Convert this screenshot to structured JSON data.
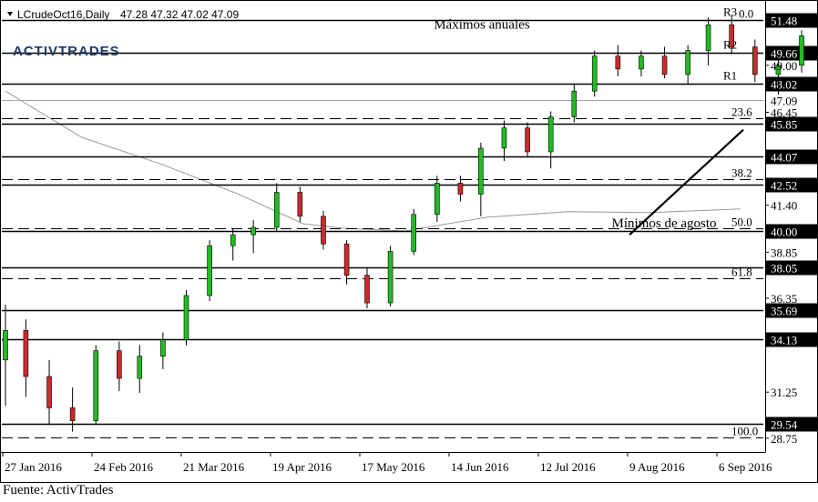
{
  "header": {
    "symbol": "LCrudeOct16,Daily",
    "ohlc": "47.28 47.32 47.02 47.09"
  },
  "logo": {
    "text": "ACTIVTRADES"
  },
  "source": "Fuente: ActivTrades",
  "colors": {
    "bull": "#22bb22",
    "bear": "#cc2a2a",
    "ma": "#999999",
    "line": "#000000"
  },
  "chart_data": {
    "type": "candlestick",
    "ylim": [
      28.1,
      52.3
    ],
    "x_axis_labels": [
      "27 Jan 2016",
      "24 Feb 2016",
      "21 Mar 2016",
      "19 Apr 2016",
      "17 May 2016",
      "14 Jun 2016",
      "12 Jul 2016",
      "9 Aug 2016",
      "6 Sep 2016"
    ],
    "price_scale_labels": [
      "49.00",
      "46.45",
      "41.40",
      "38.85",
      "36.35",
      "31.25",
      "28.75"
    ],
    "levels": [
      {
        "value": 51.48,
        "style": "solid",
        "tag": "R3",
        "tag_value": ""
      },
      {
        "value": 49.66,
        "style": "solid",
        "tag": "R2",
        "tag_value": ""
      },
      {
        "value": 48.02,
        "style": "solid",
        "tag": "R1",
        "tag_value": ""
      },
      {
        "value": 47.09,
        "style": "current",
        "tag": "",
        "tag_value": ""
      },
      {
        "value": 45.85,
        "style": "solid",
        "tag": "",
        "tag_value": ""
      },
      {
        "value": 44.07,
        "style": "solid",
        "tag": "",
        "tag_value": ""
      },
      {
        "value": 42.52,
        "style": "solid",
        "tag": "",
        "tag_value": ""
      },
      {
        "value": 40.0,
        "style": "solid",
        "tag": "",
        "tag_value": ""
      },
      {
        "value": 38.05,
        "style": "solid",
        "tag": "",
        "tag_value": ""
      },
      {
        "value": 35.69,
        "style": "solid",
        "tag": "",
        "tag_value": ""
      },
      {
        "value": 34.13,
        "style": "solid",
        "tag": "",
        "tag_value": ""
      },
      {
        "value": 29.54,
        "style": "solid",
        "tag": "",
        "tag_value": ""
      }
    ],
    "fibonacci": [
      {
        "label": "0.0",
        "value": 51.48
      },
      {
        "label": "23.6",
        "value": 46.12
      },
      {
        "label": "38.2",
        "value": 42.8
      },
      {
        "label": "50.0",
        "value": 40.13
      },
      {
        "label": "61.8",
        "value": 37.45
      },
      {
        "label": "100.0",
        "value": 28.78
      }
    ],
    "annotations": [
      {
        "text": "Máximos anuales",
        "date": "2016-05-30",
        "value": 51.0
      },
      {
        "text": "Mínimos de agosto",
        "date": "2016-07-30",
        "value": 40.2
      }
    ],
    "trendline": {
      "start": {
        "date": "2016-08-02",
        "value": 39.8
      },
      "end": {
        "date": "2016-09-10",
        "value": 45.5
      }
    },
    "moving_average": {
      "dates": [
        "2016-01-01",
        "2016-01-27",
        "2016-02-24",
        "2016-03-21",
        "2016-04-12",
        "2016-04-26",
        "2016-05-17",
        "2016-06-14",
        "2016-07-12",
        "2016-08-09",
        "2016-09-09"
      ],
      "values": [
        47.6,
        45.1,
        43.6,
        42.0,
        40.4,
        40.15,
        40.0,
        40.75,
        41.05,
        41.0,
        41.2
      ]
    },
    "closes": {
      "start_date": "2016-01-01",
      "step_days": 1,
      "values": [
        38.0,
        37.1,
        35.7,
        33.8,
        32.2,
        33.5,
        34.3,
        33.6,
        32.1,
        33.0,
        32.2,
        31.4,
        31.1,
        30.4,
        29.6,
        29.1,
        30.9,
        32.2,
        32.8,
        34.0,
        33.4,
        32.2,
        31.3,
        32.0,
        32.6,
        33.6,
        33.2,
        31.8,
        32.4,
        33.6,
        35.0,
        36.4,
        37.3,
        38.4,
        39.8,
        40.2,
        38.8,
        38.6,
        39.8,
        40.2,
        41.4,
        42.4,
        41.9,
        41.3,
        40.4,
        40.0,
        39.0,
        37.6,
        38.2,
        37.0,
        36.2,
        37.4,
        38.8,
        40.2,
        41.6,
        42.4,
        44.1,
        42.9,
        43.2,
        42.6,
        44.1,
        44.6,
        45.3,
        46.3,
        45.4,
        45.2,
        44.0,
        44.4,
        45.4,
        46.1,
        46.6,
        45.7,
        45.9,
        47.1,
        48.0,
        48.9,
        48.3,
        48.7,
        49.9,
        49.2,
        48.7,
        48.1,
        49.2,
        48.7,
        49.7,
        50.6,
        49.2,
        48.9,
        50.2,
        50.4,
        51.5,
        49.9,
        49.4,
        48.6,
        48.3,
        48.2,
        49.0,
        50.2,
        50.6,
        50.5,
        49.3,
        48.8,
        49.2,
        49.9,
        48.7,
        48.2,
        47.4,
        48.0,
        46.6,
        46.5,
        45.6,
        46.9,
        47.7,
        46.2,
        45.9,
        45.3,
        45.6,
        46.6,
        45.5,
        44.8,
        43.9,
        42.5,
        41.4,
        40.6,
        40.1,
        39.7,
        40.9,
        43.2,
        44.4,
        45.1,
        44.2,
        46.0,
        47.6,
        48.5,
        48.2,
        49.4,
        48.7,
        47.8,
        47.5,
        47.2,
        47.6,
        46.0,
        46.3,
        44.8,
        43.4,
        44.9,
        45.8,
        47.09
      ]
    },
    "candles": {
      "start_date": "2016-01-01",
      "step_days": 3,
      "dir": "uudduudduuddduuudd",
      "ohlc": [
        [
          33.0,
          36.0,
          30.5,
          34.6
        ],
        [
          34.6,
          35.2,
          31.0,
          32.1
        ],
        [
          32.1,
          33.0,
          29.5,
          30.4
        ],
        [
          30.4,
          31.5,
          29.1,
          29.7
        ],
        [
          29.7,
          33.8,
          29.5,
          33.5
        ],
        [
          33.5,
          34.0,
          31.3,
          32.0
        ],
        [
          32.0,
          33.8,
          31.2,
          33.2
        ],
        [
          33.2,
          34.5,
          32.5,
          34.1
        ],
        [
          34.1,
          36.8,
          33.8,
          36.5
        ],
        [
          36.5,
          39.5,
          36.2,
          39.2
        ],
        [
          39.2,
          40.1,
          38.4,
          39.8
        ],
        [
          39.8,
          40.6,
          38.8,
          40.2
        ],
        [
          40.2,
          42.6,
          40.0,
          42.1
        ],
        [
          42.1,
          42.4,
          40.5,
          40.8
        ],
        [
          40.8,
          41.1,
          39.0,
          39.3
        ],
        [
          39.3,
          39.5,
          37.1,
          37.6
        ],
        [
          37.6,
          38.0,
          35.8,
          36.1
        ],
        [
          36.1,
          39.2,
          35.9,
          38.9
        ],
        [
          38.9,
          41.2,
          38.7,
          40.9
        ],
        [
          40.9,
          43.0,
          40.5,
          42.6
        ],
        [
          42.6,
          43.0,
          41.6,
          42.0
        ],
        [
          42.0,
          44.8,
          40.8,
          44.5
        ],
        [
          44.5,
          46.0,
          43.8,
          45.6
        ],
        [
          45.6,
          45.9,
          44.0,
          44.3
        ],
        [
          44.3,
          46.5,
          43.4,
          46.2
        ],
        [
          46.2,
          48.0,
          45.9,
          47.6
        ],
        [
          47.6,
          49.8,
          47.3,
          49.5
        ],
        [
          49.5,
          50.1,
          48.4,
          48.8
        ],
        [
          48.8,
          49.8,
          48.4,
          49.5
        ],
        [
          49.5,
          50.0,
          48.3,
          48.5
        ],
        [
          48.5,
          50.1,
          48.0,
          49.8
        ],
        [
          49.8,
          51.6,
          49.0,
          51.2
        ],
        [
          51.2,
          51.7,
          49.6,
          50.0
        ],
        [
          50.0,
          50.4,
          48.1,
          48.5
        ],
        [
          48.5,
          49.4,
          47.4,
          49.0
        ],
        [
          49.0,
          50.9,
          48.6,
          50.6
        ],
        [
          50.6,
          51.0,
          49.2,
          49.5
        ],
        [
          49.5,
          50.0,
          48.2,
          48.6
        ],
        [
          48.6,
          49.9,
          47.5,
          49.6
        ],
        [
          49.6,
          50.0,
          47.9,
          48.3
        ],
        [
          48.3,
          48.6,
          46.1,
          46.6
        ],
        [
          46.6,
          47.0,
          45.0,
          45.4
        ],
        [
          45.4,
          47.8,
          45.1,
          47.4
        ],
        [
          47.4,
          47.9,
          45.4,
          45.8
        ],
        [
          45.8,
          46.3,
          44.5,
          44.9
        ],
        [
          44.9,
          45.0,
          42.6,
          42.9
        ],
        [
          42.9,
          43.1,
          40.6,
          41.0
        ],
        [
          41.0,
          41.2,
          39.2,
          39.6
        ],
        [
          39.6,
          42.6,
          39.5,
          42.3
        ],
        [
          42.3,
          45.4,
          42.1,
          45.0
        ],
        [
          45.0,
          47.0,
          44.8,
          46.6
        ],
        [
          46.6,
          49.3,
          46.3,
          48.9
        ],
        [
          48.9,
          49.4,
          47.0,
          47.3
        ],
        [
          47.3,
          48.3,
          46.8,
          47.6
        ],
        [
          47.6,
          47.9,
          45.7,
          46.1
        ],
        [
          46.1,
          46.3,
          43.6,
          43.9
        ],
        [
          43.9,
          45.4,
          43.6,
          45.0
        ],
        [
          45.0,
          47.6,
          44.7,
          47.09
        ]
      ]
    }
  }
}
